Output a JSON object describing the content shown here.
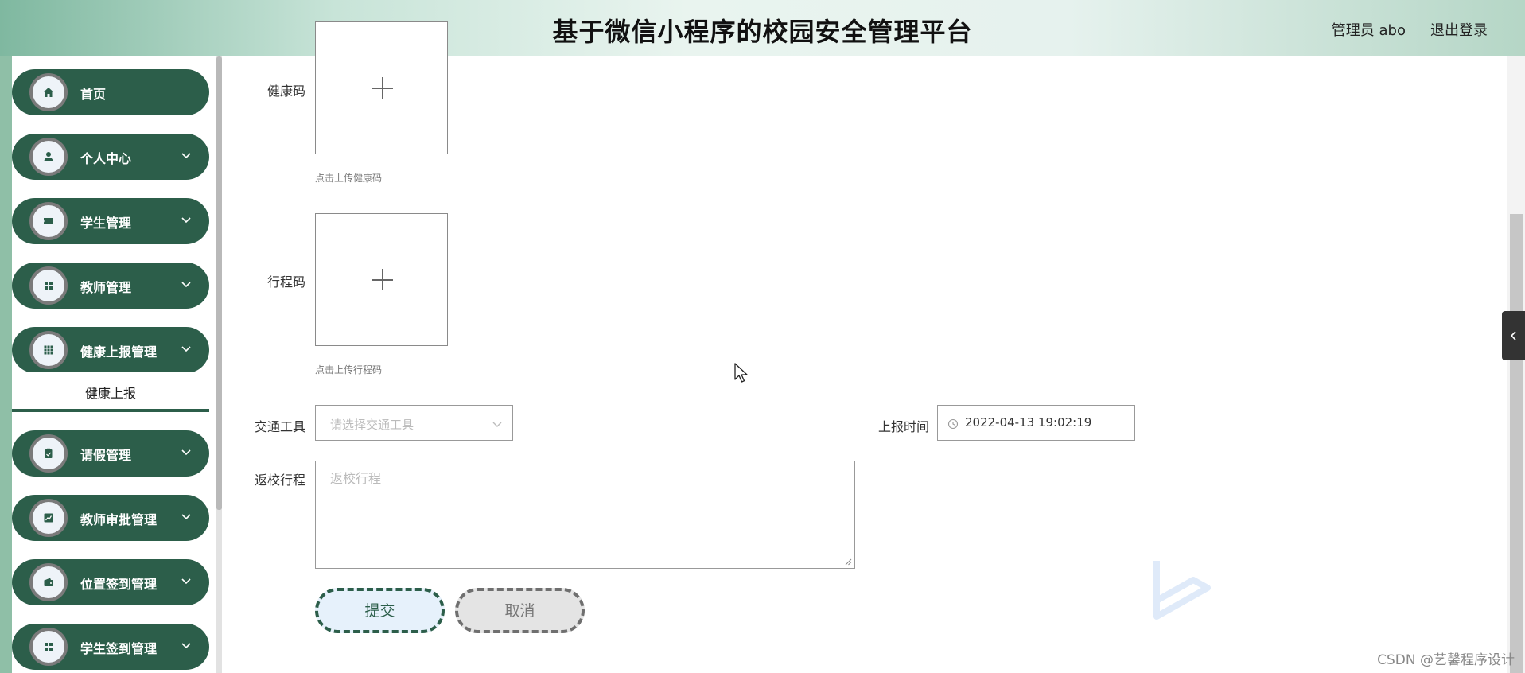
{
  "header": {
    "title": "基于微信小程序的校园安全管理平台",
    "user": "管理员 abo",
    "logout": "退出登录"
  },
  "sidebar": {
    "items": [
      {
        "label": "首页",
        "icon": "home-icon"
      },
      {
        "label": "个人中心",
        "icon": "person-icon"
      },
      {
        "label": "学生管理",
        "icon": "ticket-icon"
      },
      {
        "label": "教师管理",
        "icon": "grid-icon"
      },
      {
        "label": "健康上报管理",
        "icon": "apps-icon"
      },
      {
        "label": "请假管理",
        "icon": "clipboard-icon"
      },
      {
        "label": "教师审批管理",
        "icon": "chart-icon"
      },
      {
        "label": "位置签到管理",
        "icon": "wallet-icon"
      },
      {
        "label": "学生签到管理",
        "icon": "grid-icon"
      }
    ],
    "submenu": {
      "label": "健康上报"
    }
  },
  "form": {
    "health_code": {
      "label": "健康码",
      "hint": "点击上传健康码"
    },
    "trip_code": {
      "label": "行程码",
      "hint": "点击上传行程码"
    },
    "transport": {
      "label": "交通工具",
      "placeholder": "请选择交通工具"
    },
    "report_time": {
      "label": "上报时间",
      "value": "2022-04-13 19:02:19"
    },
    "return_trip": {
      "label": "返校行程",
      "placeholder": "返校行程"
    },
    "submit": "提交",
    "cancel": "取消"
  },
  "watermark": "CSDN @艺馨程序设计",
  "colors": {
    "primary": "#2c5e4a",
    "sidebar_bg": "#9dc6b0",
    "submit_bg": "#e6f1fb"
  }
}
